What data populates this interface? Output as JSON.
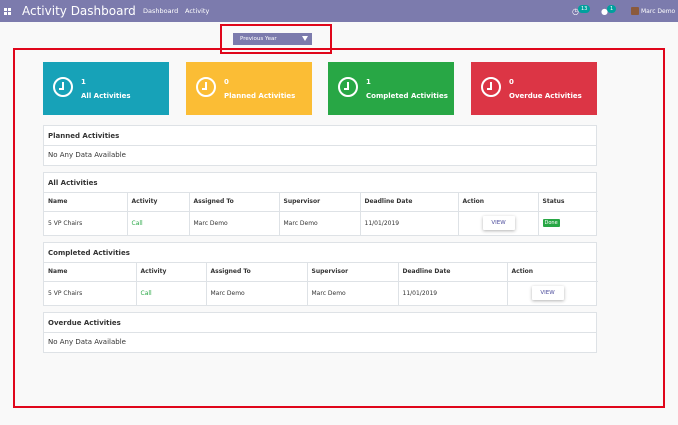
{
  "navbar": {
    "title": "Activity Dashboard",
    "links": [
      "Dashboard",
      "Activity"
    ],
    "activity_count": "13",
    "message_count": "1",
    "user_name": "Marc Demo"
  },
  "filter": {
    "selected": "Previous Year"
  },
  "cards": [
    {
      "count": "1",
      "label": "All Activities",
      "color": "#17a2b8"
    },
    {
      "count": "0",
      "label": "Planned Activities",
      "color": "#fbbd35"
    },
    {
      "count": "1",
      "label": "Completed Activities",
      "color": "#28a745"
    },
    {
      "count": "0",
      "label": "Overdue Activities",
      "color": "#dc3545"
    }
  ],
  "planned": {
    "title": "Planned Activities",
    "empty_text": "No Any Data Available"
  },
  "all": {
    "title": "All Activities",
    "columns": [
      "Name",
      "Activity",
      "Assigned To",
      "Supervisor",
      "Deadline Date",
      "Action",
      "Status"
    ],
    "rows": [
      {
        "name": "5 VP Chairs",
        "activity": "Call",
        "assigned_to": "Marc Demo",
        "supervisor": "Marc Demo",
        "deadline": "11/01/2019",
        "action": "VIEW",
        "status": "Done"
      }
    ]
  },
  "completed": {
    "title": "Completed Activities",
    "columns": [
      "Name",
      "Activity",
      "Assigned To",
      "Supervisor",
      "Deadline Date",
      "Action"
    ],
    "rows": [
      {
        "name": "5 VP Chairs",
        "activity": "Call",
        "assigned_to": "Marc Demo",
        "supervisor": "Marc Demo",
        "deadline": "11/01/2019",
        "action": "VIEW"
      }
    ]
  },
  "overdue": {
    "title": "Overdue Activities",
    "empty_text": "No Any Data Available"
  }
}
